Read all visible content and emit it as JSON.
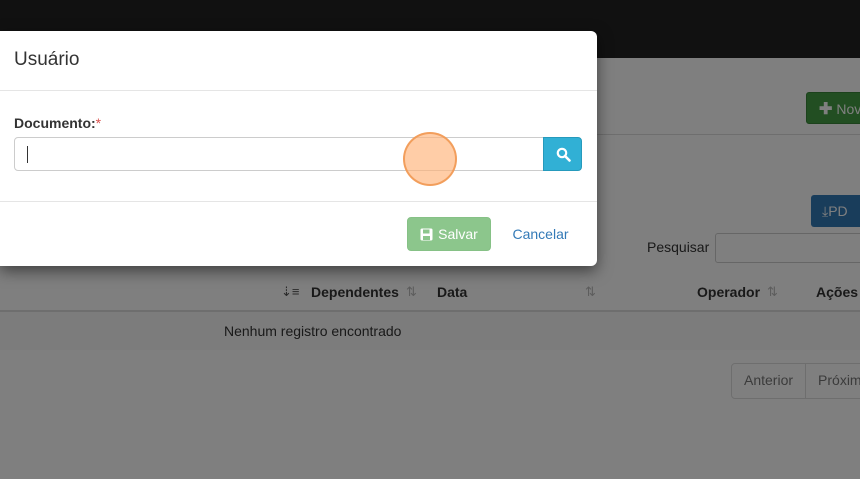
{
  "background": {
    "new_button_label": "Nov",
    "pdf_button_label": "PD",
    "search_label": "Pesquisar",
    "search_value": "",
    "table": {
      "columns": [
        "Dependentes",
        "Data",
        "Operador",
        "Ações"
      ],
      "empty_message": "Nenhum registro encontrado"
    },
    "pagination": {
      "prev_label": "Anterior",
      "next_label": "Próxim"
    }
  },
  "modal": {
    "title": "Usuário",
    "document_field": {
      "label": "Documento:",
      "required_marker": "*",
      "value": ""
    },
    "save_label": "Salvar",
    "cancel_label": "Cancelar"
  },
  "colors": {
    "success": "#449d44",
    "primary": "#337ab7",
    "info": "#31b0d5",
    "save_disabled": "#8cc68c",
    "required": "#d9534f"
  },
  "icons": [
    "plus-icon",
    "download-icon",
    "search-icon",
    "save-icon",
    "sort-icon"
  ]
}
